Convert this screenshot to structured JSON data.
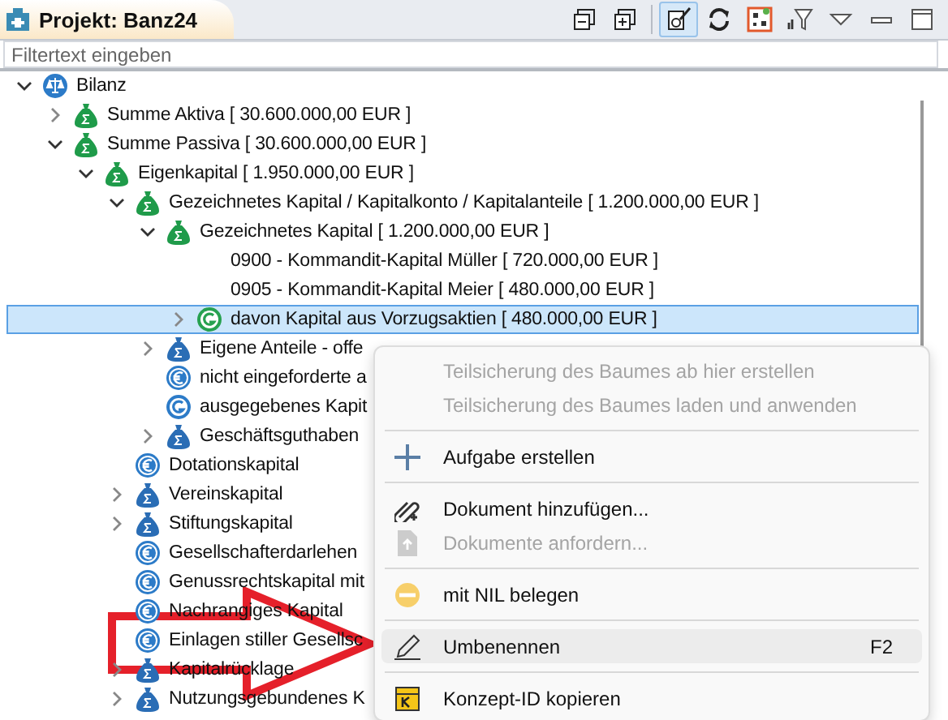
{
  "view_tab": {
    "title": "Projekt: Banz24"
  },
  "toolbar": [
    {
      "kind": "collapse-all",
      "pressed": false
    },
    {
      "kind": "expand-all",
      "pressed": false
    },
    {
      "kind": "link",
      "pressed": true
    },
    {
      "kind": "sync",
      "pressed": false
    },
    {
      "kind": "grid",
      "pressed": false
    },
    {
      "kind": "filter",
      "pressed": false
    },
    {
      "kind": "view-menu",
      "pressed": false
    },
    {
      "kind": "minimize",
      "pressed": false
    },
    {
      "kind": "maximize",
      "pressed": false
    }
  ],
  "filter": {
    "placeholder": "Filtertext eingeben"
  },
  "tree": [
    {
      "label": "Bilanz",
      "kind": "scale",
      "expanded": true,
      "selected": false,
      "children": [
        {
          "label": "Summe Aktiva  [ 30.600.000,00 EUR ]",
          "kind": "bag-green",
          "expanded": false,
          "selected": false
        },
        {
          "label": "Summe Passiva  [ 30.600.000,00 EUR ]",
          "kind": "bag-green",
          "expanded": true,
          "selected": false,
          "children": [
            {
              "label": "Eigenkapital  [ 1.950.000,00 EUR ]",
              "kind": "bag-green",
              "expanded": true,
              "selected": false,
              "children": [
                {
                  "label": "Gezeichnetes Kapital / Kapitalkonto / Kapitalanteile  [ 1.200.000,00 EUR ]",
                  "kind": "bag-green",
                  "expanded": true,
                  "selected": false,
                  "children": [
                    {
                      "label": "Gezeichnetes Kapital  [ 1.200.000,00 EUR ]",
                      "kind": "bag-green",
                      "expanded": true,
                      "selected": false,
                      "children": [
                        {
                          "label": "0900  -  Kommandit-Kapital Müller  [ 720.000,00 EUR ]",
                          "kind": "account",
                          "selected": false
                        },
                        {
                          "label": "0905  -  Kommandit-Kapital Meier  [ 480.000,00 EUR ]",
                          "kind": "account",
                          "selected": false
                        },
                        {
                          "label": "davon Kapital aus Vorzugsaktien  [ 480.000,00 EUR ]",
                          "kind": "g-green",
                          "expanded": false,
                          "selected": true
                        }
                      ]
                    },
                    {
                      "label": "Eigene Anteile - offe",
                      "kind": "bag-blue",
                      "expanded": false,
                      "selected": false
                    },
                    {
                      "label": "nicht eingeforderte a",
                      "kind": "euro",
                      "selected": false
                    },
                    {
                      "label": "ausgegebenes Kapit",
                      "kind": "g-blue",
                      "selected": false
                    },
                    {
                      "label": "Geschäftsguthaben",
                      "kind": "bag-blue",
                      "expanded": false,
                      "selected": false
                    }
                  ]
                },
                {
                  "label": "Dotationskapital",
                  "kind": "euro",
                  "selected": false
                },
                {
                  "label": "Vereinskapital",
                  "kind": "bag-blue",
                  "expanded": false,
                  "selected": false
                },
                {
                  "label": "Stiftungskapital",
                  "kind": "bag-blue",
                  "expanded": false,
                  "selected": false
                },
                {
                  "label": "Gesellschafterdarlehen",
                  "kind": "euro",
                  "selected": false
                },
                {
                  "label": "Genussrechtskapital mit",
                  "kind": "euro",
                  "selected": false
                },
                {
                  "label": "Nachrangiges Kapital",
                  "kind": "euro",
                  "selected": false
                },
                {
                  "label": "Einlagen stiller Gesellsc",
                  "kind": "euro",
                  "selected": false
                },
                {
                  "label": "Kapitalrücklage",
                  "kind": "bag-blue",
                  "expanded": false,
                  "selected": false
                },
                {
                  "label": "Nutzungsgebundenes K",
                  "kind": "bag-blue",
                  "expanded": false,
                  "selected": false
                }
              ]
            }
          ]
        }
      ]
    }
  ],
  "context_menu": {
    "groups": [
      [
        {
          "label": "Teilsicherung des Baumes ab hier erstellen",
          "kind": "plain",
          "disabled": true,
          "highlighted": false
        },
        {
          "label": "Teilsicherung des Baumes laden und anwenden",
          "kind": "plain",
          "disabled": true,
          "highlighted": false
        }
      ],
      [
        {
          "label": "Aufgabe erstellen",
          "kind": "plus",
          "disabled": false,
          "highlighted": false
        }
      ],
      [
        {
          "label": "Dokument hinzufügen...",
          "kind": "paperclip",
          "disabled": false,
          "highlighted": false
        },
        {
          "label": "Dokumente anfordern...",
          "kind": "document",
          "disabled": true,
          "highlighted": false
        }
      ],
      [
        {
          "label": "mit NIL belegen",
          "kind": "nil",
          "disabled": false,
          "highlighted": false
        }
      ],
      [
        {
          "label": "Umbenennen",
          "kind": "pencil",
          "disabled": false,
          "highlighted": true,
          "shortcut": "F2"
        }
      ],
      [
        {
          "label": "Konzept-ID kopieren",
          "kind": "concept",
          "disabled": false,
          "highlighted": false
        }
      ]
    ]
  }
}
